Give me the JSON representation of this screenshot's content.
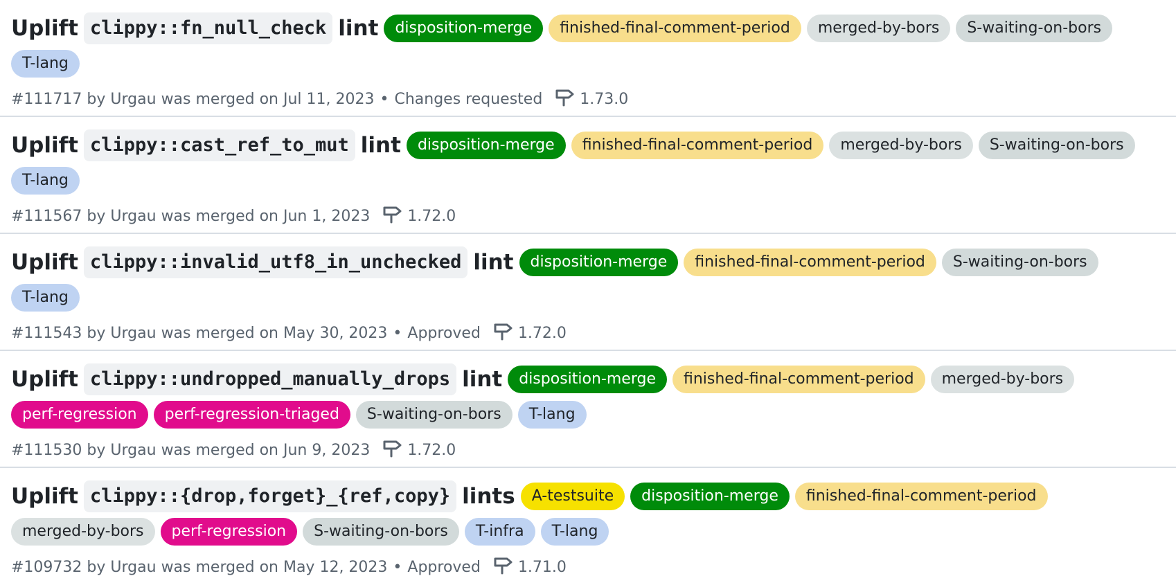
{
  "label_colors": {
    "disposition-merge": {
      "bg": "#008b0a",
      "fg": "#ffffff"
    },
    "finished-final-comment-period": {
      "bg": "#f8de8c",
      "fg": "#1f2328"
    },
    "merged-by-bors": {
      "bg": "#dbe1e1",
      "fg": "#1f2328"
    },
    "S-waiting-on-bors": {
      "bg": "#d2dada",
      "fg": "#1f2328"
    },
    "T-lang": {
      "bg": "#bfd3f2",
      "fg": "#1f2328"
    },
    "T-infra": {
      "bg": "#bfd3f2",
      "fg": "#1f2328"
    },
    "perf-regression": {
      "bg": "#e10c8c",
      "fg": "#ffffff"
    },
    "perf-regression-triaged": {
      "bg": "#e10c8c",
      "fg": "#ffffff"
    },
    "A-testsuite": {
      "bg": "#f6e100",
      "fg": "#1f2328"
    }
  },
  "milestone_icon": "milestone-signpost-icon",
  "pull_requests": [
    {
      "title_prefix": "Uplift",
      "title_code": "clippy::fn_null_check",
      "title_suffix": "lint",
      "labels": [
        "disposition-merge",
        "finished-final-comment-period",
        "merged-by-bors",
        "S-waiting-on-bors",
        "T-lang"
      ],
      "number": "#111717",
      "author_prefix": "by",
      "author": "Urgau",
      "merged_text": "was merged on Jul 11, 2023",
      "separator": "•",
      "review_status": "Changes requested",
      "milestone": "1.73.0"
    },
    {
      "title_prefix": "Uplift",
      "title_code": "clippy::cast_ref_to_mut",
      "title_suffix": "lint",
      "labels": [
        "disposition-merge",
        "finished-final-comment-period",
        "merged-by-bors",
        "S-waiting-on-bors",
        "T-lang"
      ],
      "number": "#111567",
      "author_prefix": "by",
      "author": "Urgau",
      "merged_text": "was merged on Jun 1, 2023",
      "separator": "",
      "review_status": "",
      "milestone": "1.72.0"
    },
    {
      "title_prefix": "Uplift",
      "title_code": "clippy::invalid_utf8_in_unchecked",
      "title_suffix": "lint",
      "labels": [
        "disposition-merge",
        "finished-final-comment-period",
        "S-waiting-on-bors",
        "T-lang"
      ],
      "number": "#111543",
      "author_prefix": "by",
      "author": "Urgau",
      "merged_text": "was merged on May 30, 2023",
      "separator": "•",
      "review_status": "Approved",
      "milestone": "1.72.0"
    },
    {
      "title_prefix": "Uplift",
      "title_code": "clippy::undropped_manually_drops",
      "title_suffix": "lint",
      "labels": [
        "disposition-merge",
        "finished-final-comment-period",
        "merged-by-bors",
        "perf-regression",
        "perf-regression-triaged",
        "S-waiting-on-bors",
        "T-lang"
      ],
      "number": "#111530",
      "author_prefix": "by",
      "author": "Urgau",
      "merged_text": "was merged on Jun 9, 2023",
      "separator": "",
      "review_status": "",
      "milestone": "1.72.0"
    },
    {
      "title_prefix": "Uplift",
      "title_code": "clippy::{drop,forget}_{ref,copy}",
      "title_suffix": "lints",
      "labels": [
        "A-testsuite",
        "disposition-merge",
        "finished-final-comment-period",
        "merged-by-bors",
        "perf-regression",
        "S-waiting-on-bors",
        "T-infra",
        "T-lang"
      ],
      "number": "#109732",
      "author_prefix": "by",
      "author": "Urgau",
      "merged_text": "was merged on May 12, 2023",
      "separator": "•",
      "review_status": "Approved",
      "milestone": "1.71.0"
    }
  ]
}
